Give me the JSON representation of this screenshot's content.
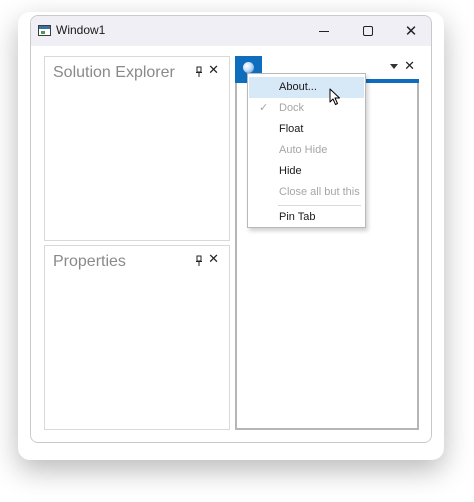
{
  "window": {
    "title": "Window1",
    "caption_buttons": [
      "minimize",
      "maximize",
      "close"
    ],
    "close_glyph": "✕"
  },
  "panes": [
    {
      "title": "Solution Explorer",
      "close_glyph": "✕"
    },
    {
      "title": "Properties",
      "close_glyph": "✕"
    }
  ],
  "document": {
    "tab_icon": "blue-ball-icon",
    "close_glyph": "✕"
  },
  "context_menu": {
    "items": [
      {
        "label": "About...",
        "enabled": true,
        "highlighted": true
      },
      {
        "label": "Dock",
        "enabled": false,
        "checked": true
      },
      {
        "label": "Float",
        "enabled": true
      },
      {
        "label": "Auto Hide",
        "enabled": false
      },
      {
        "label": "Hide",
        "enabled": true
      },
      {
        "label": "Close all but this",
        "enabled": false
      },
      {
        "label": "Pin Tab",
        "enabled": true
      }
    ],
    "check_glyph": "✓"
  },
  "colors": {
    "accent": "#0f6dbd",
    "titlebar": "#f1eff6",
    "menu_highlight": "#d7e8f7",
    "disabled_text": "#a6a6a6"
  }
}
